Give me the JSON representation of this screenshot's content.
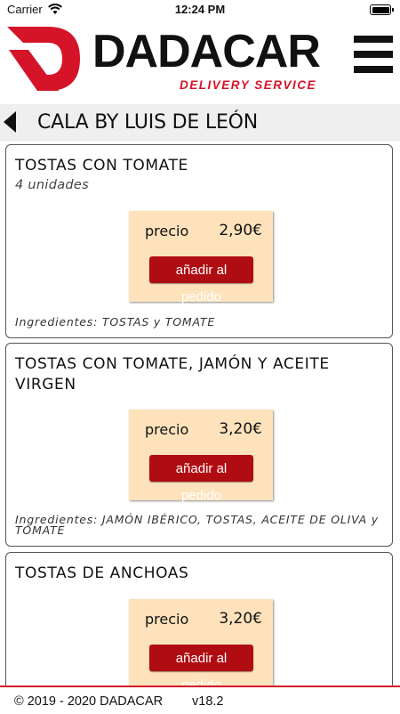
{
  "status_bar": {
    "carrier": "Carrier",
    "time": "12:24 PM"
  },
  "header": {
    "brand": "DADACAR",
    "tagline": "DELIVERY SERVICE",
    "accent_color": "#d5142a"
  },
  "page": {
    "title": "CALA BY LUIS DE LEÓN"
  },
  "products": [
    {
      "name": "TOSTAS CON TOMATE",
      "units": "4 unidades",
      "price_label": "precio",
      "price": "2,90€",
      "button": "añadir al pedido",
      "ingredients": "Ingredientes: TOSTAS y TOMATE"
    },
    {
      "name": "TOSTAS CON TOMATE, JAMÓN Y ACEITE VIRGEN",
      "units": "",
      "price_label": "precio",
      "price": "3,20€",
      "button": "añadir al pedido",
      "ingredients": "Ingredientes: JAMÓN IBÉRICO, TOSTAS, ACEITE DE OLIVA y TOMATE"
    },
    {
      "name": "TOSTAS DE ANCHOAS",
      "units": "",
      "price_label": "precio",
      "price": "3,20€",
      "button": "añadir al pedido",
      "ingredients": ""
    }
  ],
  "footer": {
    "copyright": "© 2019 - 2020 DADACAR",
    "version": "v18.2"
  }
}
